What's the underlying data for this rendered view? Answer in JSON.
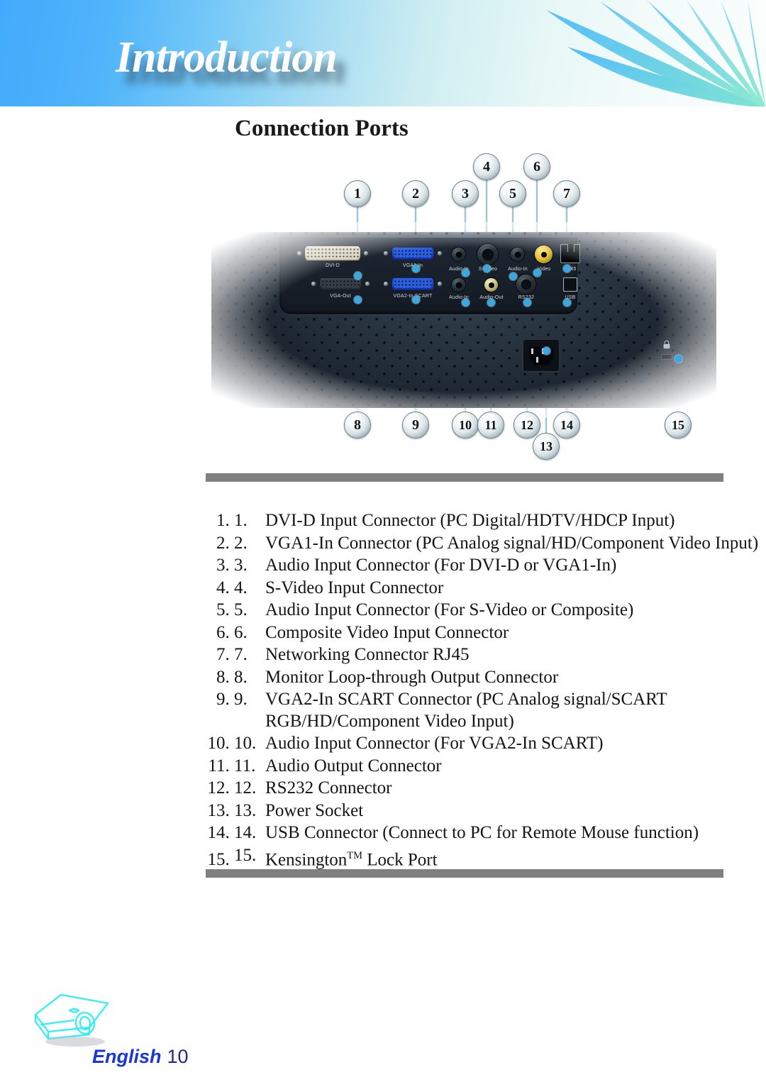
{
  "header": {
    "title": "Introduction",
    "decoration": "feather-fan-graphic",
    "gradient_from": "#44aafb",
    "gradient_to": "#fbfefd"
  },
  "section": {
    "heading": "Connection Ports"
  },
  "diagram": {
    "device": "projector-rear-panel",
    "callouts_top": [
      {
        "id": "1",
        "label": "1"
      },
      {
        "id": "2",
        "label": "2"
      },
      {
        "id": "3",
        "label": "3"
      },
      {
        "id": "4",
        "label": "4"
      },
      {
        "id": "5",
        "label": "5"
      },
      {
        "id": "6",
        "label": "6"
      },
      {
        "id": "7",
        "label": "7"
      }
    ],
    "callouts_bottom": [
      {
        "id": "8",
        "label": "8"
      },
      {
        "id": "9",
        "label": "9"
      },
      {
        "id": "10",
        "label": "10"
      },
      {
        "id": "11",
        "label": "11"
      },
      {
        "id": "12",
        "label": "12"
      },
      {
        "id": "13",
        "label": "13"
      },
      {
        "id": "14",
        "label": "14"
      },
      {
        "id": "15",
        "label": "15"
      }
    ],
    "port_labels_top": [
      "DVI-D",
      "VGA1-In",
      "Audio-In",
      "S-Video",
      "Audio-In",
      "Video",
      "RJ45"
    ],
    "port_labels_bottom": [
      "VGA-Out",
      "VGA2-In SCART",
      "Audio-In",
      "Audio-Out",
      "RS232",
      "USB"
    ],
    "accent_dot_color": "#3aa8e0"
  },
  "list": {
    "items": [
      {
        "num": "1.",
        "text": "DVI-D Input Connector (PC Digital/HDTV/HDCP Input)"
      },
      {
        "num": "2.",
        "text": "VGA1-In Connector (PC Analog signal/HD/Component Video Input)"
      },
      {
        "num": "3.",
        "text": "Audio Input Connector (For DVI-D or VGA1-In)"
      },
      {
        "num": "4.",
        "text": "S-Video Input Connector"
      },
      {
        "num": "5.",
        "text": "Audio Input Connector (For S-Video or Composite)"
      },
      {
        "num": "6.",
        "text": "Composite Video Input Connector"
      },
      {
        "num": "7.",
        "text": "Networking Connector RJ45"
      },
      {
        "num": "8.",
        "text": "Monitor Loop-through Output Connector"
      },
      {
        "num": "9.",
        "text": "VGA2-In SCART Connector (PC Analog signal/SCART RGB/HD/Component Video Input)"
      },
      {
        "num": "10.",
        "text": "Audio Input Connector (For VGA2-In SCART)"
      },
      {
        "num": "11.",
        "text": "Audio Output Connector"
      },
      {
        "num": "12.",
        "text": "RS232 Connector"
      },
      {
        "num": "13.",
        "text": "Power Socket"
      },
      {
        "num": "14.",
        "text": "USB Connector (Connect to PC for Remote Mouse function)"
      },
      {
        "num": "15.",
        "text": "Kensington™ Lock Port"
      }
    ],
    "rule_color": "#808080"
  },
  "footer": {
    "language": "English",
    "page": "10",
    "icon": "projector-icon",
    "lang_color": "#1a36d8"
  }
}
